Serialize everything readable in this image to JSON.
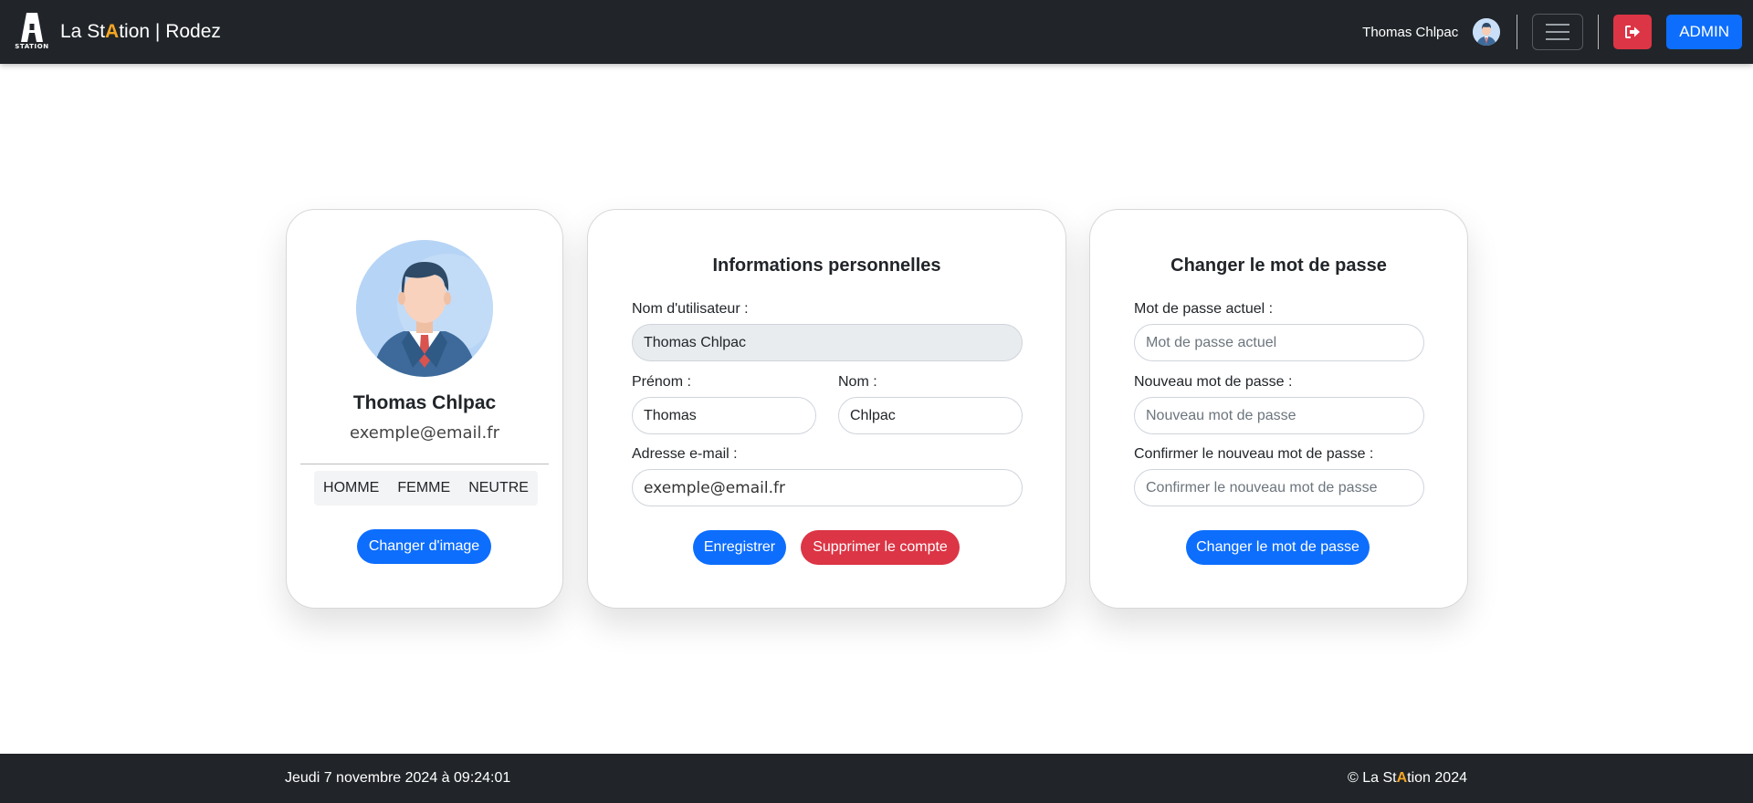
{
  "navbar": {
    "logo_text": "STATION",
    "brand_prefix": "La St",
    "brand_highlight": "A",
    "brand_suffix": "tion | Rodez",
    "user_name": "Thomas Chlpac",
    "admin_label": "ADMIN",
    "accent_color": "#f5a623"
  },
  "profile": {
    "name": "Thomas Chlpac",
    "email": "exemple@email.fr",
    "genders": [
      "HOMME",
      "FEMME",
      "NEUTRE"
    ],
    "change_image_label": "Changer d'image"
  },
  "info": {
    "title": "Informations personnelles",
    "username_label": "Nom d'utilisateur :",
    "username_value": "Thomas Chlpac",
    "firstname_label": "Prénom :",
    "firstname_value": "Thomas",
    "lastname_label": "Nom :",
    "lastname_value": "Chlpac",
    "email_label": "Adresse e-mail :",
    "email_value": "exemple@email.fr",
    "save_label": "Enregistrer",
    "delete_label": "Supprimer le compte"
  },
  "password": {
    "title": "Changer le mot de passe",
    "current_label": "Mot de passe actuel :",
    "current_placeholder": "Mot de passe actuel",
    "new_label": "Nouveau mot de passe :",
    "new_placeholder": "Nouveau mot de passe",
    "confirm_label": "Confirmer le nouveau mot de passe :",
    "confirm_placeholder": "Confirmer le nouveau mot de passe",
    "submit_label": "Changer le mot de passe"
  },
  "footer": {
    "datetime": "Jeudi 7 novembre 2024 à 09:24:01",
    "copy_prefix": "© La St",
    "copy_highlight": "A",
    "copy_suffix": "tion 2024"
  },
  "colors": {
    "primary": "#0d6efd",
    "danger": "#dc3545",
    "dark": "#212529"
  }
}
